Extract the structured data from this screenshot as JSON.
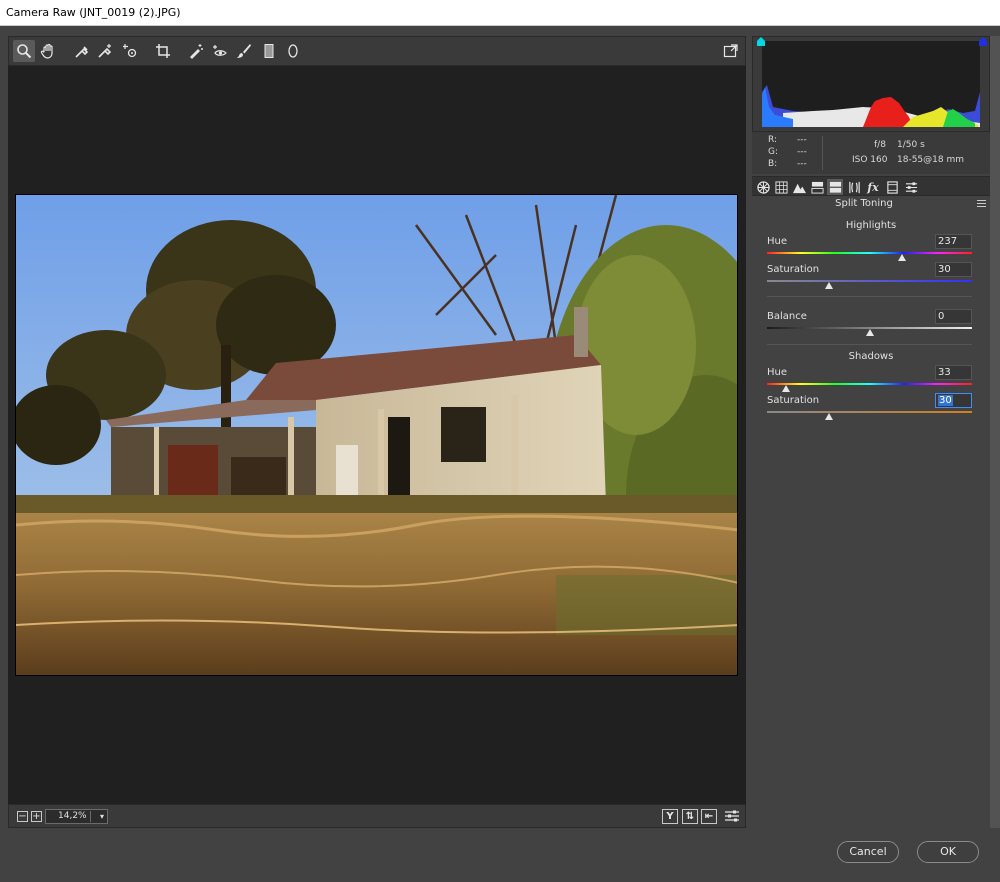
{
  "window": {
    "title": "Camera Raw (JNT_0019 (2).JPG)"
  },
  "toolbar": {
    "tools": [
      "zoom-icon",
      "hand-icon",
      "white-balance-icon",
      "color-sampler-icon",
      "targeted-adjustment-icon",
      "crop-icon",
      "spot-removal-icon",
      "red-eye-icon",
      "adjustment-brush-icon",
      "graduated-filter-icon",
      "radial-filter-icon"
    ],
    "open_prefs_icon": "toggle-fullscreen-icon"
  },
  "histogram": {
    "readout": {
      "r_label": "R:",
      "g_label": "G:",
      "b_label": "B:",
      "r": "---",
      "g": "---",
      "b": "---"
    },
    "exif": {
      "aperture": "f/8",
      "shutter": "1/50 s",
      "iso": "ISO 160",
      "lens": "18-55@18 mm"
    }
  },
  "panel": {
    "title": "Split Toning",
    "highlights": {
      "heading": "Highlights",
      "hue_label": "Hue",
      "hue": "237",
      "hue_fraction": 0.658,
      "saturation_label": "Saturation",
      "saturation": "30",
      "saturation_fraction": 0.3
    },
    "balance": {
      "label": "Balance",
      "value": "0",
      "fraction": 0.5
    },
    "shadows": {
      "heading": "Shadows",
      "hue_label": "Hue",
      "hue": "33",
      "hue_fraction": 0.092,
      "saturation_label": "Saturation",
      "saturation": "30",
      "saturation_fraction": 0.3
    }
  },
  "zoom": {
    "value": "14,2%"
  },
  "buttons": {
    "cancel": "Cancel",
    "ok": "OK"
  },
  "colors": {
    "accent": "#3574d4",
    "panel_bg": "#424242",
    "canvas_bg": "#202020"
  }
}
